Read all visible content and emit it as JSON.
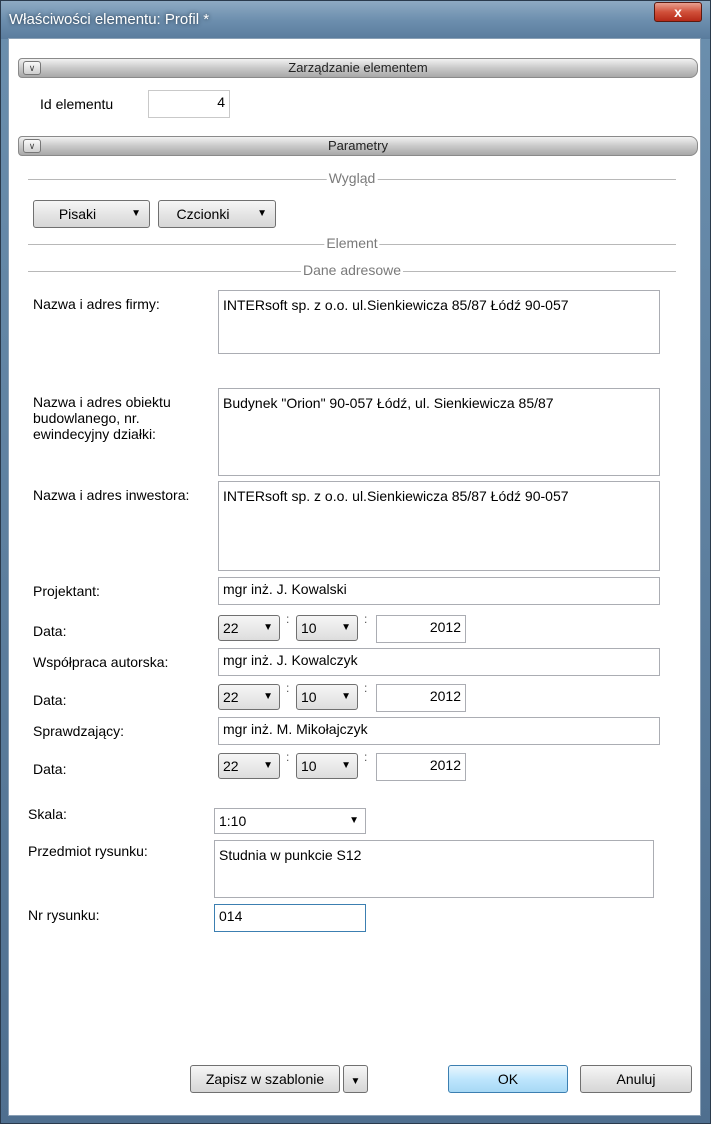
{
  "window": {
    "title": "Właściwości elementu: Profil *",
    "close_label": "x"
  },
  "groups": {
    "zarzadzanie": "Zarządzanie elementem",
    "parametry": "Parametry"
  },
  "id_element": {
    "label": "Id elementu",
    "value": "4"
  },
  "separators": {
    "wyglad": "Wygląd",
    "element": "Element",
    "dane": "Dane adresowe"
  },
  "buttons": {
    "pisaki": "Pisaki",
    "czcionki": "Czcionki",
    "zapisz": "Zapisz w szablonie",
    "ok": "OK",
    "anuluj": "Anuluj"
  },
  "fields": {
    "firma": {
      "label": "Nazwa i adres firmy:",
      "value": "INTERsoft sp. z o.o. ul.Sienkiewicza 85/87 Łódź 90-057"
    },
    "obiekt": {
      "label": "Nazwa i adres obiektu budowlanego, nr. ewindecyjny działki:",
      "value": "Budynek \"Orion\" 90-057 Łódź, ul. Sienkiewicza 85/87"
    },
    "inwestor": {
      "label": "Nazwa i adres inwestora:",
      "value": "INTERsoft sp. z o.o. ul.Sienkiewicza 85/87 Łódź 90-057"
    },
    "projektant": {
      "label": "Projektant:",
      "value": "mgr inż. J. Kowalski"
    },
    "wspolpraca": {
      "label": "Współpraca autorska:",
      "value": "mgr inż. J. Kowalczyk"
    },
    "sprawdzajacy": {
      "label": "Sprawdzający:",
      "value": "mgr inż. M. Mikołajczyk"
    },
    "skala": {
      "label": "Skala:",
      "value": "1:10"
    },
    "przedmiot": {
      "label": "Przedmiot rysunku:",
      "value": "Studnia w punkcie S12"
    },
    "nr": {
      "label": "Nr rysunku:",
      "value": "014"
    }
  },
  "dates": {
    "label": "Data:",
    "projektant": {
      "day": "22",
      "month": "10",
      "year": "2012"
    },
    "wspolpraca": {
      "day": "22",
      "month": "10",
      "year": "2012"
    },
    "sprawdzajacy": {
      "day": "22",
      "month": "10",
      "year": "2012"
    }
  },
  "colors": {
    "titlebar": "#6d8fae",
    "ok_button": "#bee6fd",
    "close_button": "#d0503a"
  }
}
